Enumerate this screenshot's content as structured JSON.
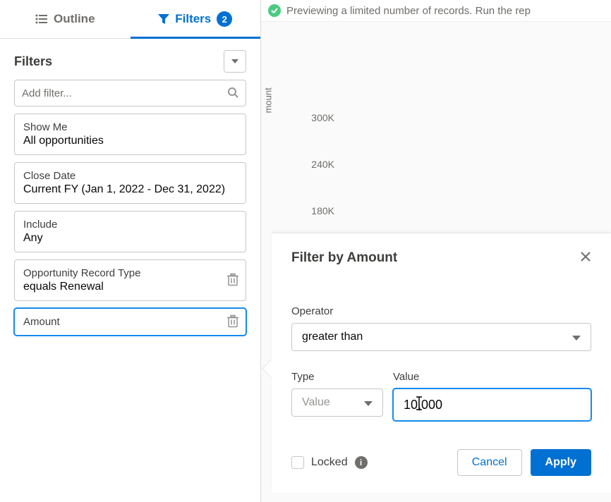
{
  "tabs": {
    "outline_label": "Outline",
    "filters_label": "Filters",
    "filter_count": "2"
  },
  "panel": {
    "title": "Filters",
    "search_placeholder": "Add filter..."
  },
  "filters": [
    {
      "label": "Show Me",
      "value": "All opportunities"
    },
    {
      "label": "Close Date",
      "value": "Current FY (Jan 1, 2022 - Dec 31, 2022)"
    },
    {
      "label": "Include",
      "value": "Any"
    },
    {
      "label": "Opportunity Record Type",
      "value": "equals Renewal"
    },
    {
      "label": "Amount",
      "value": ""
    }
  ],
  "preview_message": "Previewing a limited number of records. Run the rep",
  "chart_data": {
    "type": "bar",
    "y_ticks": [
      "300K",
      "240K",
      "180K"
    ],
    "ylabel": "mount"
  },
  "popover": {
    "title": "Filter by Amount",
    "operator_label": "Operator",
    "operator_value": "greater than",
    "type_label": "Type",
    "type_value": "Value",
    "value_label": "Value",
    "value_input": "10,000",
    "locked_label": "Locked",
    "cancel_label": "Cancel",
    "apply_label": "Apply"
  }
}
